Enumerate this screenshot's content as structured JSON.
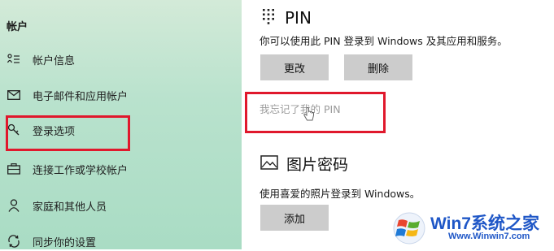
{
  "sidebar": {
    "section_title": "帐户",
    "items": [
      {
        "label": "帐户信息",
        "icon": "person-info-icon"
      },
      {
        "label": "电子邮件和应用帐户",
        "icon": "mail-icon"
      },
      {
        "label": "登录选项",
        "icon": "key-icon"
      },
      {
        "label": "连接工作或学校帐户",
        "icon": "briefcase-icon"
      },
      {
        "label": "家庭和其他人员",
        "icon": "person-icon"
      },
      {
        "label": "同步你的设置",
        "icon": "sync-icon"
      }
    ]
  },
  "pin": {
    "title": "PIN",
    "description": "你可以使用此 PIN 登录到 Windows 及其应用和服务。",
    "change_label": "更改",
    "remove_label": "删除",
    "forgot_link": "我忘记了我的 PIN"
  },
  "picture_password": {
    "title": "图片密码",
    "description": "使用喜爱的照片登录到 Windows。",
    "add_label": "添加"
  },
  "watermark": {
    "name": "Win7系统之家",
    "url": "Www.Winwin7.com"
  },
  "colors": {
    "highlight": "#e0182c",
    "button": "#cccccc",
    "sidebar_bg": "#b9e2cd",
    "brand_blue": "#1f57c7"
  }
}
